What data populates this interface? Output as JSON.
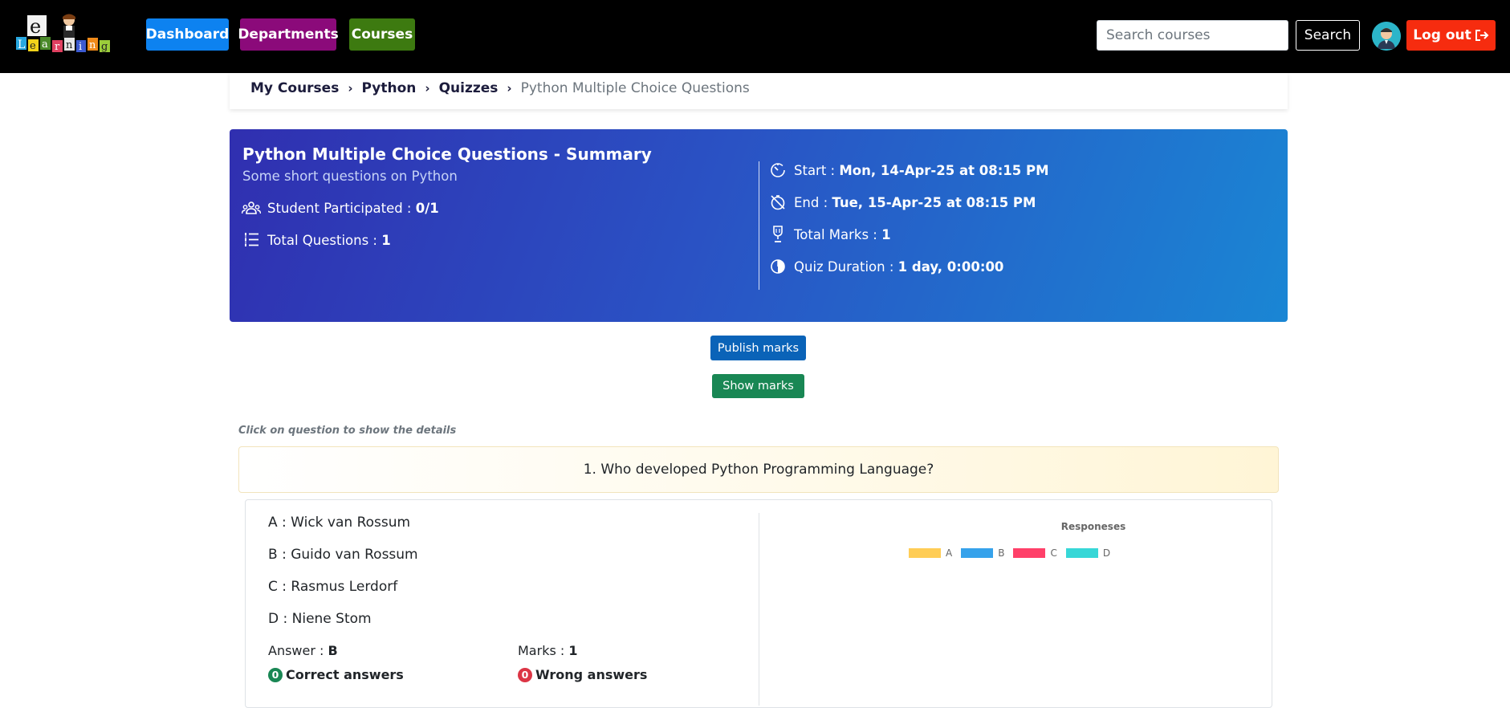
{
  "navbar": {
    "logo_text": "eLearning",
    "nav_items": [
      "Dashboard",
      "Departments",
      "Courses"
    ],
    "search": {
      "placeholder": "Search courses",
      "value": ""
    },
    "search_button": "Search",
    "logout_button": "Log out",
    "colors": {
      "dashboard": "#0d82f0",
      "departments": "#8b0a7a",
      "courses": "#3d7a10",
      "logout": "#f62c0f"
    }
  },
  "breadcrumb": {
    "items": [
      "My Courses",
      "Python",
      "Quizzes"
    ],
    "current": "Python Multiple Choice Questions"
  },
  "summary": {
    "title": "Python Multiple Choice Questions - Summary",
    "subtitle": "Some short questions on Python",
    "participated_label": "Student Participated :",
    "participated_value": "0/1",
    "total_questions_label": "Total Questions :",
    "total_questions_value": "1",
    "start_label": "Start :",
    "start_value": "Mon, 14-Apr-25 at 08:15 PM",
    "end_label": "End :",
    "end_value": "Tue, 15-Apr-25 at 08:15 PM",
    "total_marks_label": "Total Marks :",
    "total_marks_value": "1",
    "duration_label": "Quiz Duration :",
    "duration_value": "1 day, 0:00:00"
  },
  "actions": {
    "publish": "Publish marks",
    "show": "Show marks"
  },
  "hint": "Click on question to show the details",
  "question": {
    "text": "1. Who developed Python Programming Language?",
    "options": [
      "A : Wick van Rossum",
      "B : Guido van Rossum",
      "C : Rasmus Lerdorf",
      "D : Niene Stom"
    ],
    "answer_label": "Answer :",
    "answer_value": "B",
    "marks_label": "Marks :",
    "marks_value": "1",
    "correct_count": "0",
    "correct_label": "Correct answers",
    "wrong_count": "0",
    "wrong_label": "Wrong answers"
  },
  "responses_chart": {
    "title": "Responeses",
    "legend": [
      {
        "label": "A",
        "color": "#ffcd56"
      },
      {
        "label": "B",
        "color": "#36a2eb"
      },
      {
        "label": "C",
        "color": "#ff4069"
      },
      {
        "label": "D",
        "color": "#37d7d7"
      }
    ]
  }
}
